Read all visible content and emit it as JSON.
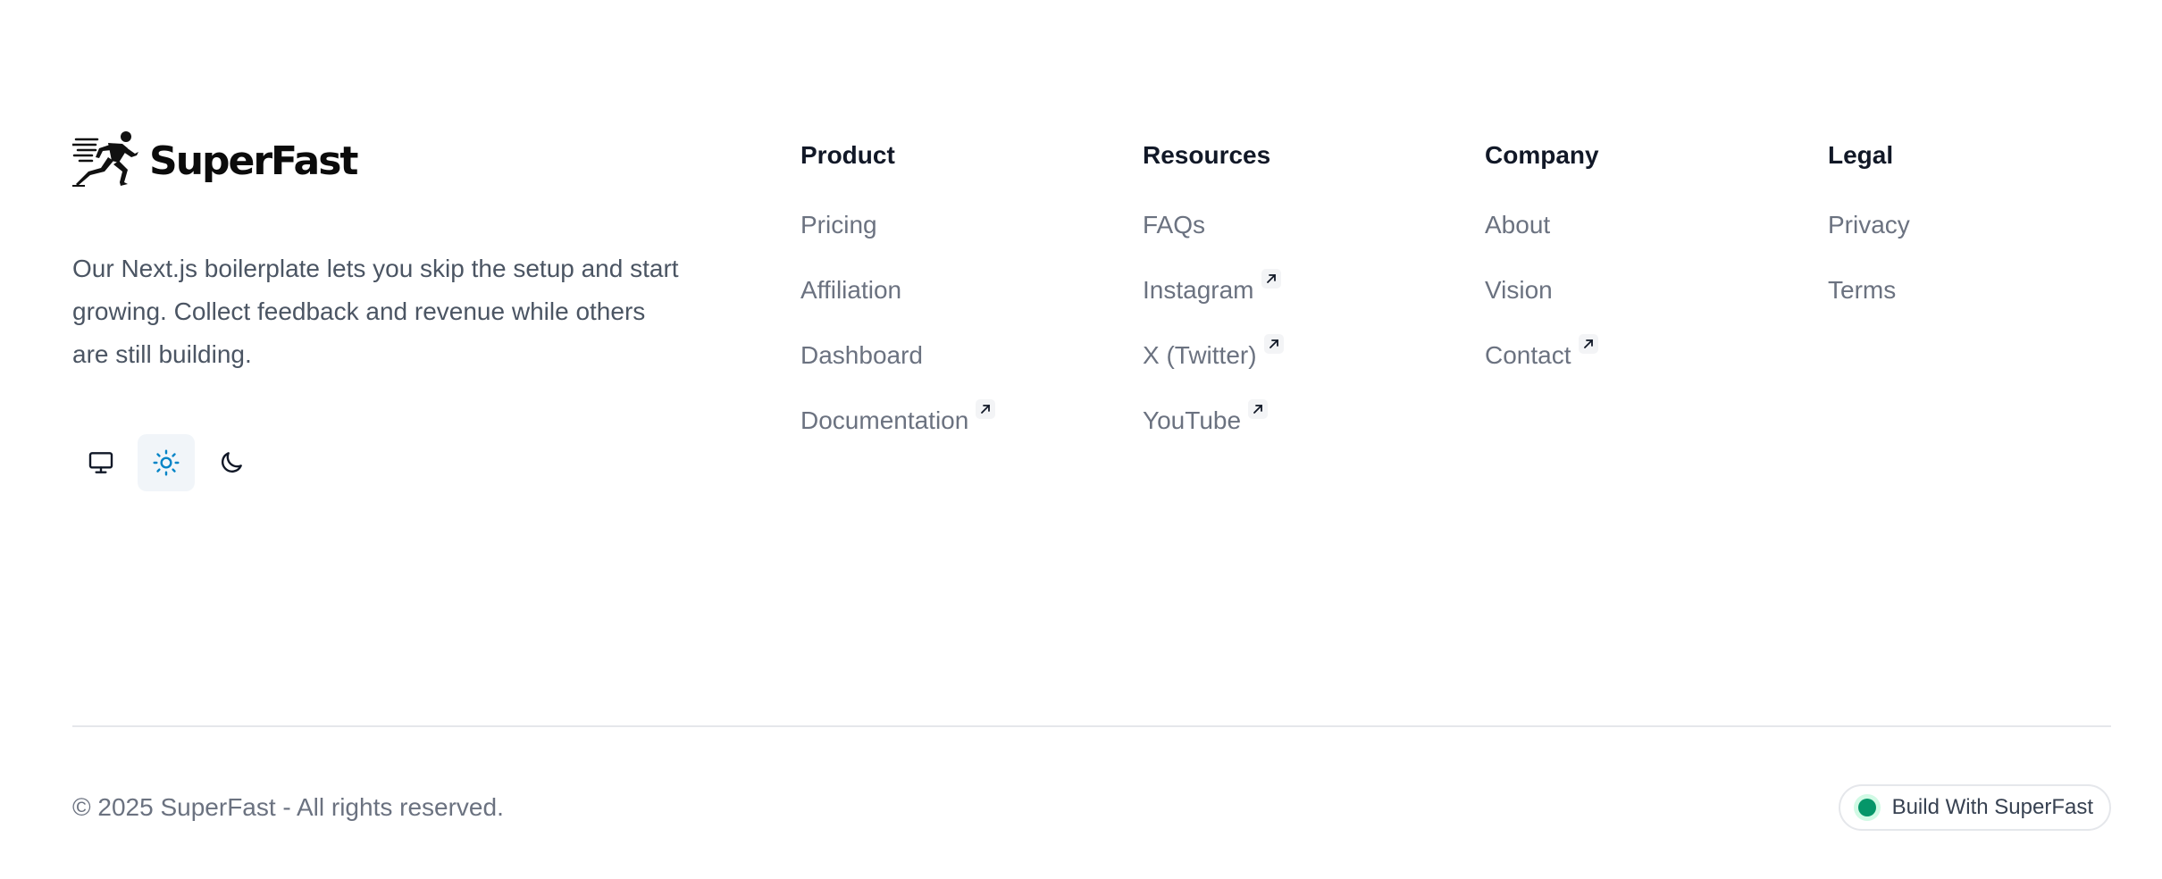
{
  "brand": {
    "name": "SuperFast",
    "description": "Our Next.js boilerplate lets you skip the setup and start growing. Collect feedback and revenue while others are still building."
  },
  "theme_switcher": {
    "options": [
      {
        "icon": "monitor-icon",
        "active": false
      },
      {
        "icon": "sun-icon",
        "active": true
      },
      {
        "icon": "moon-icon",
        "active": false
      }
    ],
    "active_color": "#0284c7"
  },
  "columns": [
    {
      "title": "Product",
      "links": [
        {
          "label": "Pricing",
          "external": false
        },
        {
          "label": "Affiliation",
          "external": false
        },
        {
          "label": "Dashboard",
          "external": false
        },
        {
          "label": "Documentation",
          "external": true
        }
      ]
    },
    {
      "title": "Resources",
      "links": [
        {
          "label": "FAQs",
          "external": false
        },
        {
          "label": "Instagram",
          "external": true
        },
        {
          "label": "X (Twitter)",
          "external": true
        },
        {
          "label": "YouTube",
          "external": true
        }
      ]
    },
    {
      "title": "Company",
      "links": [
        {
          "label": "About",
          "external": false
        },
        {
          "label": "Vision",
          "external": false
        },
        {
          "label": "Contact",
          "external": true
        }
      ]
    },
    {
      "title": "Legal",
      "links": [
        {
          "label": "Privacy",
          "external": false
        },
        {
          "label": "Terms",
          "external": false
        }
      ]
    }
  ],
  "bottom": {
    "copyright": "© 2025 SuperFast - All rights reserved.",
    "badge_label": "Build With SuperFast",
    "badge_dot_color": "#059669"
  }
}
